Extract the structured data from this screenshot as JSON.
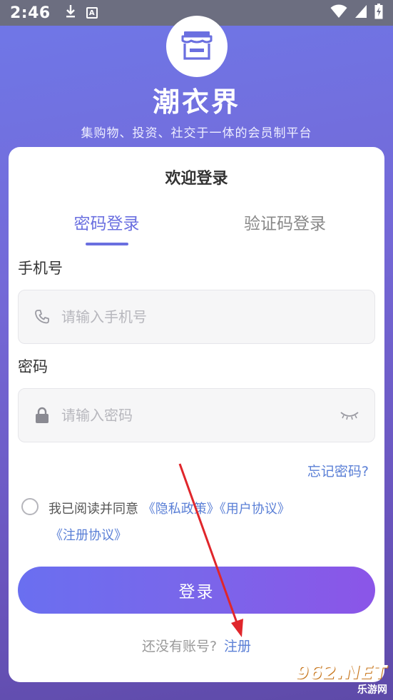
{
  "status_bar": {
    "time": "2:46",
    "a_badge": "A"
  },
  "app": {
    "title": "潮衣界",
    "subtitle": "集购物、投资、社交于一体的会员制平台"
  },
  "card": {
    "title": "欢迎登录",
    "tabs": [
      {
        "label": "密码登录",
        "active": true
      },
      {
        "label": "验证码登录",
        "active": false
      }
    ],
    "phone": {
      "label": "手机号",
      "placeholder": "请输入手机号",
      "value": ""
    },
    "password": {
      "label": "密码",
      "placeholder": "请输入密码",
      "value": ""
    },
    "forgot_label": "忘记密码?",
    "agreement": {
      "prefix": "我已阅读并同意",
      "privacy": "《隐私政策》",
      "user": "《用户协议》",
      "register": "《注册协议》",
      "checked": false
    },
    "login_label": "登录",
    "register_prompt": "还没有账号?",
    "register_label": "注册"
  },
  "watermark": {
    "main_num": "962",
    "main_suffix": ".NET",
    "sub": "乐游网"
  },
  "colors": {
    "accent": "#6a6fe0",
    "link": "#5a7fd6",
    "arrow": "#e0262b"
  }
}
